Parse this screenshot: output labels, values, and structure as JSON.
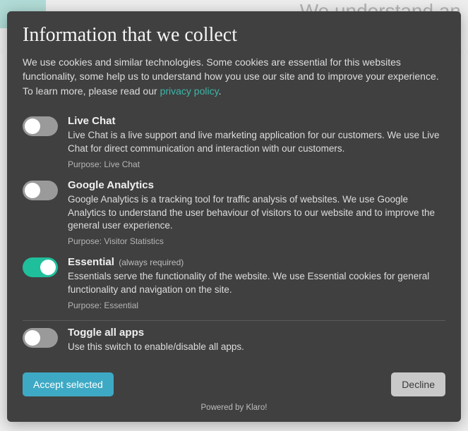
{
  "background": {
    "partial_heading": "We  understand  an"
  },
  "modal": {
    "title": "Information that we collect",
    "intro_before_link": "We use cookies and similar technologies. Some cookies are essential for this websites functionality, some help us to understand how you use our site and to improve your experience.  To learn more, please read our ",
    "privacy_link": "privacy policy",
    "intro_after_link": ".",
    "items": [
      {
        "key": "livechat",
        "title": "Live Chat",
        "required_label": "",
        "desc": "Live Chat is a live support and live marketing application for our customers. We use Live Chat for direct communication and interaction with our customers.",
        "purpose": "Purpose: Live Chat",
        "on": false,
        "locked": false
      },
      {
        "key": "ga",
        "title": "Google Analytics",
        "required_label": "",
        "desc": "Google Analytics is a tracking tool for traffic analysis of websites. We use Google Analytics to understand the user behaviour of visitors to our website and to improve the general user experience.",
        "purpose": "Purpose: Visitor Statistics",
        "on": false,
        "locked": false
      },
      {
        "key": "essential",
        "title": "Essential",
        "required_label": " (always required)",
        "desc": "Essentials serve the functionality of the website. We use Essential cookies for general functionality and navigation on the site.",
        "purpose": "Purpose: Essential",
        "on": true,
        "locked": true
      }
    ],
    "toggle_all": {
      "title": "Toggle all apps",
      "desc": "Use this switch to enable/disable all apps.",
      "on": false
    },
    "accept_label": "Accept selected",
    "decline_label": "Decline",
    "powered": "Powered by Klaro!"
  }
}
